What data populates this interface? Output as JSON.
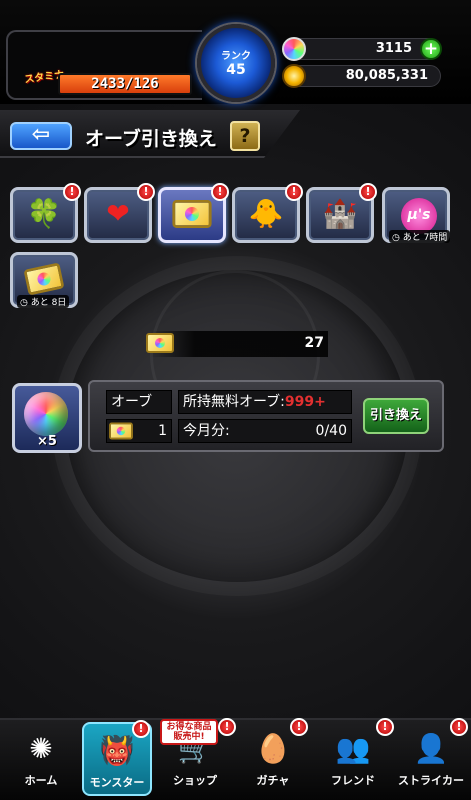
{
  "status": {
    "stamina_label": "スタミナ",
    "stamina": "2433/126",
    "rank_label": "ランク",
    "rank": "45",
    "orbs": "3115",
    "gold": "80,085,331"
  },
  "header": {
    "back_glyph": "⇦",
    "title": "オーブ引き換え",
    "help_glyph": "?"
  },
  "items": [
    {
      "icon": "clover-hat-icon",
      "glyph": "🍀",
      "badge": "!"
    },
    {
      "icon": "heart-card-icon",
      "glyph": "❤",
      "badge": "!"
    },
    {
      "icon": "orb-ticket-icon",
      "glyph": "",
      "badge": "!"
    },
    {
      "icon": "yellow-monster-icon",
      "glyph": "🐥",
      "badge": "!"
    },
    {
      "icon": "castle-icon",
      "glyph": "🏰",
      "badge": "!"
    },
    {
      "icon": "pink-logo-icon",
      "glyph": "μ's",
      "timer": "あと 7時間"
    },
    {
      "icon": "ticket-exchange-icon",
      "glyph": "🎫",
      "timer": "あと 8日"
    }
  ],
  "ticket_count": "27",
  "exchange": {
    "orb_qty": "×5",
    "orb_label": "オーブ",
    "free_orb_label": "所持無料オーブ:",
    "free_orb_value": "999+",
    "cost": "1",
    "month_label": "今月分:",
    "month_value": "0/40",
    "button": "引き換え"
  },
  "nav": {
    "sale_tag": "お得な商品 販売中!",
    "items": [
      {
        "label": "ホーム",
        "icon": "home-icon",
        "glyph": "✺",
        "badge": ""
      },
      {
        "label": "モンスター",
        "icon": "monster-icon",
        "glyph": "👹",
        "badge": "!"
      },
      {
        "label": "ショップ",
        "icon": "cart-icon",
        "glyph": "🛒",
        "badge": "!"
      },
      {
        "label": "ガチャ",
        "icon": "egg-icon",
        "glyph": "🥚",
        "badge": "!"
      },
      {
        "label": "フレンド",
        "icon": "friends-icon",
        "glyph": "👥",
        "badge": "!"
      },
      {
        "label": "ストライカー",
        "icon": "striker-icon",
        "glyph": "👤",
        "badge": "!"
      }
    ]
  },
  "colors": {
    "accent_red": "#e43030",
    "button_green": "#2a8a2a",
    "back_blue": "#1857c9",
    "stamina_orange": "#ff7a2a"
  }
}
